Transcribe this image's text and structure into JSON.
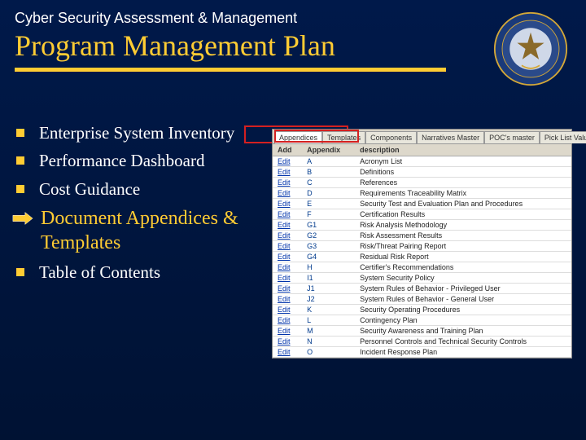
{
  "header": {
    "subtitle": "Cyber Security Assessment & Management",
    "title": "Program Management Plan"
  },
  "bullets": {
    "b1": "Enterprise System Inventory",
    "b2": "Performance Dashboard",
    "b3": "Cost Guidance",
    "b4": "Document Appendices & Templates",
    "b5": "Table of Contents"
  },
  "tabs": {
    "t1": "Appendices",
    "t2": "Templates",
    "t3": "Components",
    "t4": "Narratives Master",
    "t5": "POC's master",
    "t6": "Pick List Values"
  },
  "table": {
    "headers": {
      "h1": "Add",
      "h2": "Appendix",
      "h3": "description"
    },
    "rows": [
      {
        "add": "Edit",
        "apx": "A",
        "desc": "Acronym List"
      },
      {
        "add": "Edit",
        "apx": "B",
        "desc": "Definitions"
      },
      {
        "add": "Edit",
        "apx": "C",
        "desc": "References"
      },
      {
        "add": "Edit",
        "apx": "D",
        "desc": "Requirements Traceability Matrix"
      },
      {
        "add": "Edit",
        "apx": "E",
        "desc": "Security Test and Evaluation Plan and Procedures"
      },
      {
        "add": "Edit",
        "apx": "F",
        "desc": "Certification Results"
      },
      {
        "add": "Edit",
        "apx": "G1",
        "desc": "Risk Analysis Methodology"
      },
      {
        "add": "Edit",
        "apx": "G2",
        "desc": "Risk Assessment Results"
      },
      {
        "add": "Edit",
        "apx": "G3",
        "desc": "Risk/Threat Pairing Report"
      },
      {
        "add": "Edit",
        "apx": "G4",
        "desc": "Residual Risk Report"
      },
      {
        "add": "Edit",
        "apx": "H",
        "desc": "Certifier's Recommendations"
      },
      {
        "add": "Edit",
        "apx": "I1",
        "desc": "System Security Policy"
      },
      {
        "add": "Edit",
        "apx": "J1",
        "desc": "System Rules of Behavior - Privileged User"
      },
      {
        "add": "Edit",
        "apx": "J2",
        "desc": "System Rules of Behavior - General User"
      },
      {
        "add": "Edit",
        "apx": "K",
        "desc": "Security Operating Procedures"
      },
      {
        "add": "Edit",
        "apx": "L",
        "desc": "Contingency Plan"
      },
      {
        "add": "Edit",
        "apx": "M",
        "desc": "Security Awareness and Training Plan"
      },
      {
        "add": "Edit",
        "apx": "N",
        "desc": "Personnel Controls and Technical Security Controls"
      },
      {
        "add": "Edit",
        "apx": "O",
        "desc": "Incident Response Plan"
      }
    ]
  }
}
